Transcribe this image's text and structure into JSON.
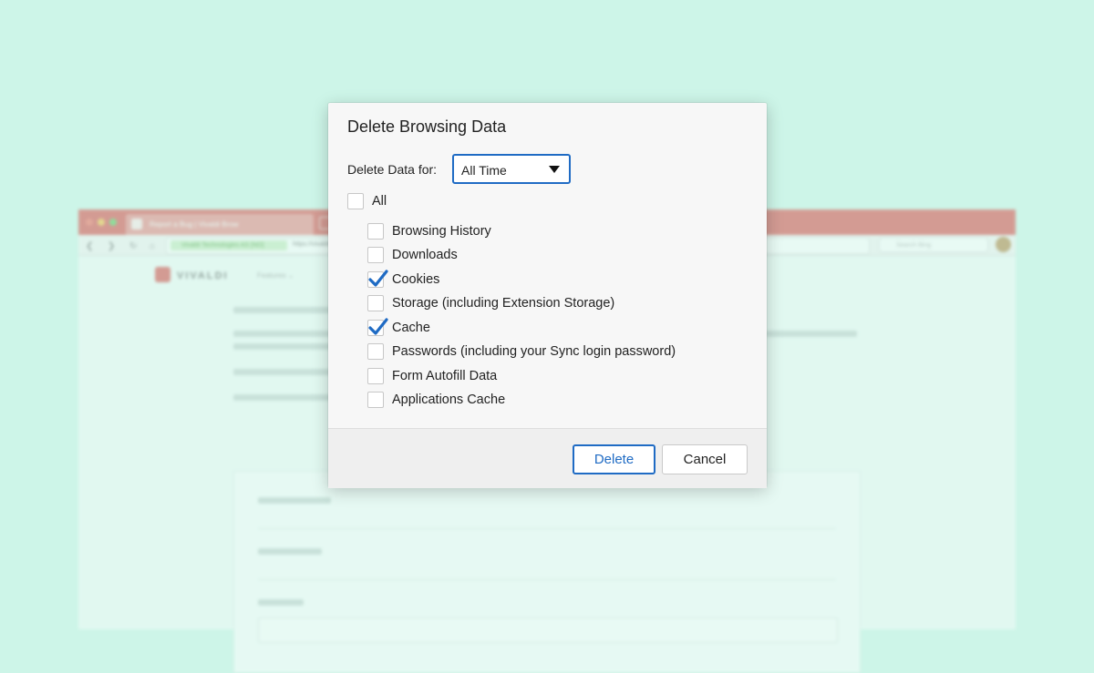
{
  "background_browser": {
    "tab_title": "Report a Bug | Vivaldi Brow",
    "secure_label": "Vivaldi Technologies AS [NO]",
    "url": "https://vivaldi.com/bugreport/",
    "search_placeholder": "Search Bing",
    "logo": "VIVALDI",
    "nav_features": "Features ⌄",
    "accent_color": "#d9534f"
  },
  "dialog": {
    "title": "Delete Browsing Data",
    "period_label": "Delete Data for:",
    "period_value": "All Time",
    "options": [
      {
        "label": "All",
        "checked": false
      },
      {
        "label": "Browsing History",
        "checked": false
      },
      {
        "label": "Downloads",
        "checked": false
      },
      {
        "label": "Cookies",
        "checked": true
      },
      {
        "label": "Storage (including Extension Storage)",
        "checked": false
      },
      {
        "label": "Cache",
        "checked": true
      },
      {
        "label": "Passwords (including your Sync login password)",
        "checked": false
      },
      {
        "label": "Form Autofill Data",
        "checked": false
      },
      {
        "label": "Applications Cache",
        "checked": false
      }
    ],
    "delete_label": "Delete",
    "cancel_label": "Cancel",
    "accent_color": "#1f6bc4"
  }
}
